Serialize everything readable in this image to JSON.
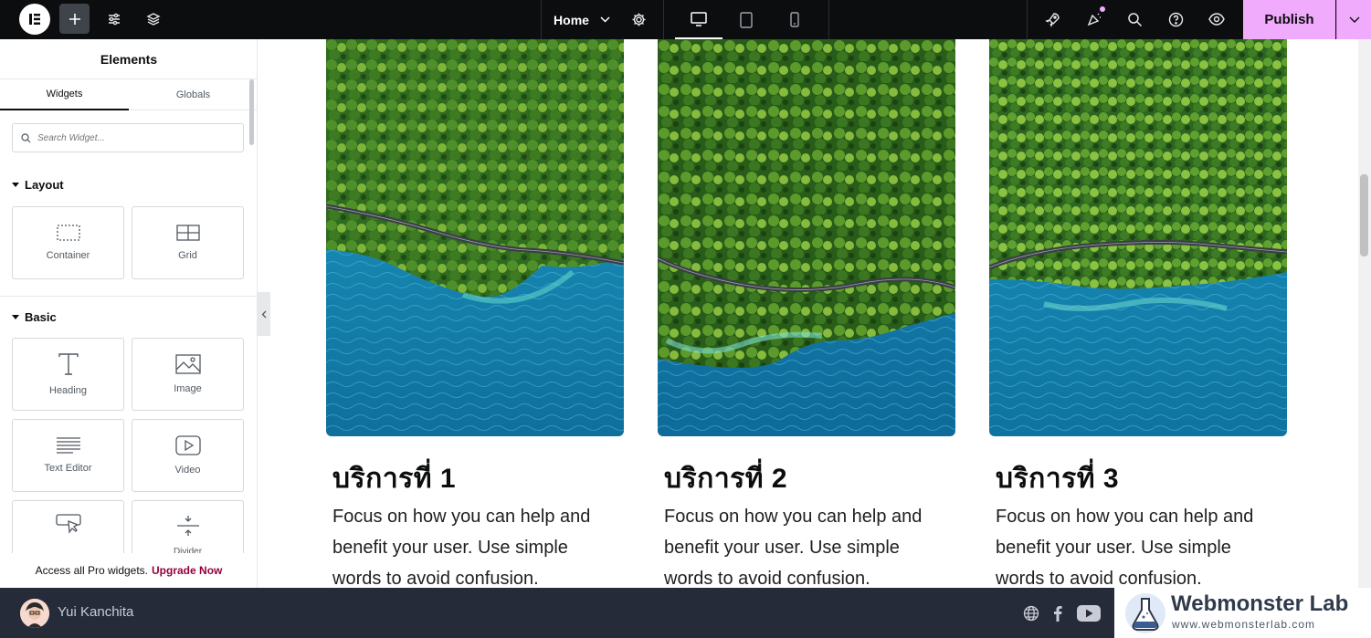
{
  "topbar": {
    "page_name": "Home",
    "publish_label": "Publish",
    "accent_color": "#f0abfc"
  },
  "panel": {
    "title": "Elements",
    "tabs": [
      "Widgets",
      "Globals"
    ],
    "search_placeholder": "Search Widget...",
    "categories": [
      {
        "name": "Layout",
        "widgets": [
          "Container",
          "Grid"
        ]
      },
      {
        "name": "Basic",
        "widgets": [
          "Heading",
          "Image",
          "Text Editor",
          "Video",
          "",
          "Divider"
        ]
      }
    ],
    "promo_text": "Access all Pro widgets.",
    "promo_link": "Upgrade Now"
  },
  "cards": [
    {
      "title": "บริการที่ 1",
      "text": "Focus on how you can help and benefit your user. Use simple words to avoid confusion."
    },
    {
      "title": "บริการที่ 2",
      "text": "Focus on how you can help and benefit your user. Use simple words to avoid confusion."
    },
    {
      "title": "บริการที่ 3",
      "text": "Focus on how you can help and benefit your user. Use simple words to avoid confusion."
    }
  ],
  "footer": {
    "user_name": "Yui Kanchita",
    "brand_name": "Webmonster Lab",
    "brand_url": "www.webmonsterlab.com"
  }
}
